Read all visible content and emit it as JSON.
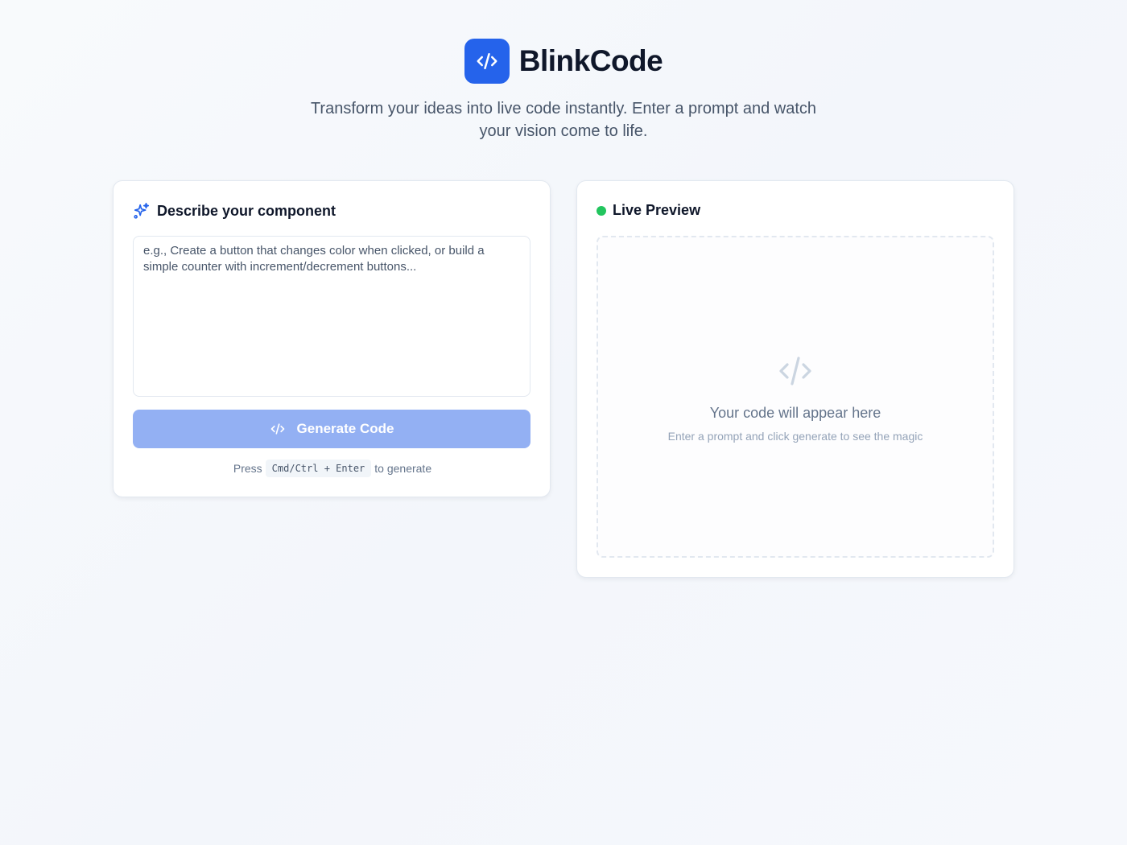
{
  "app": {
    "title": "BlinkCode",
    "tagline": "Transform your ideas into live code instantly. Enter a prompt and watch your vision come to life.",
    "logo_icon": "code-icon",
    "accent": "#2563eb"
  },
  "left_panel": {
    "title": "Describe your component",
    "title_icon": "sparkles-icon",
    "prompt_placeholder": "e.g., Create a button that changes color when clicked, or build a simple counter with increment/decrement buttons...",
    "prompt_value": "",
    "generate_label": "Generate Code",
    "generate_icon": "code-icon",
    "hint_prefix": "Press",
    "hint_shortcut": "Cmd/Ctrl + Enter",
    "hint_suffix": "to generate"
  },
  "right_panel": {
    "title": "Live Preview",
    "status_color": "#22c55e",
    "empty_icon": "code-icon",
    "empty_title": "Your code will appear here",
    "empty_subtitle": "Enter a prompt and click generate to see the magic"
  }
}
